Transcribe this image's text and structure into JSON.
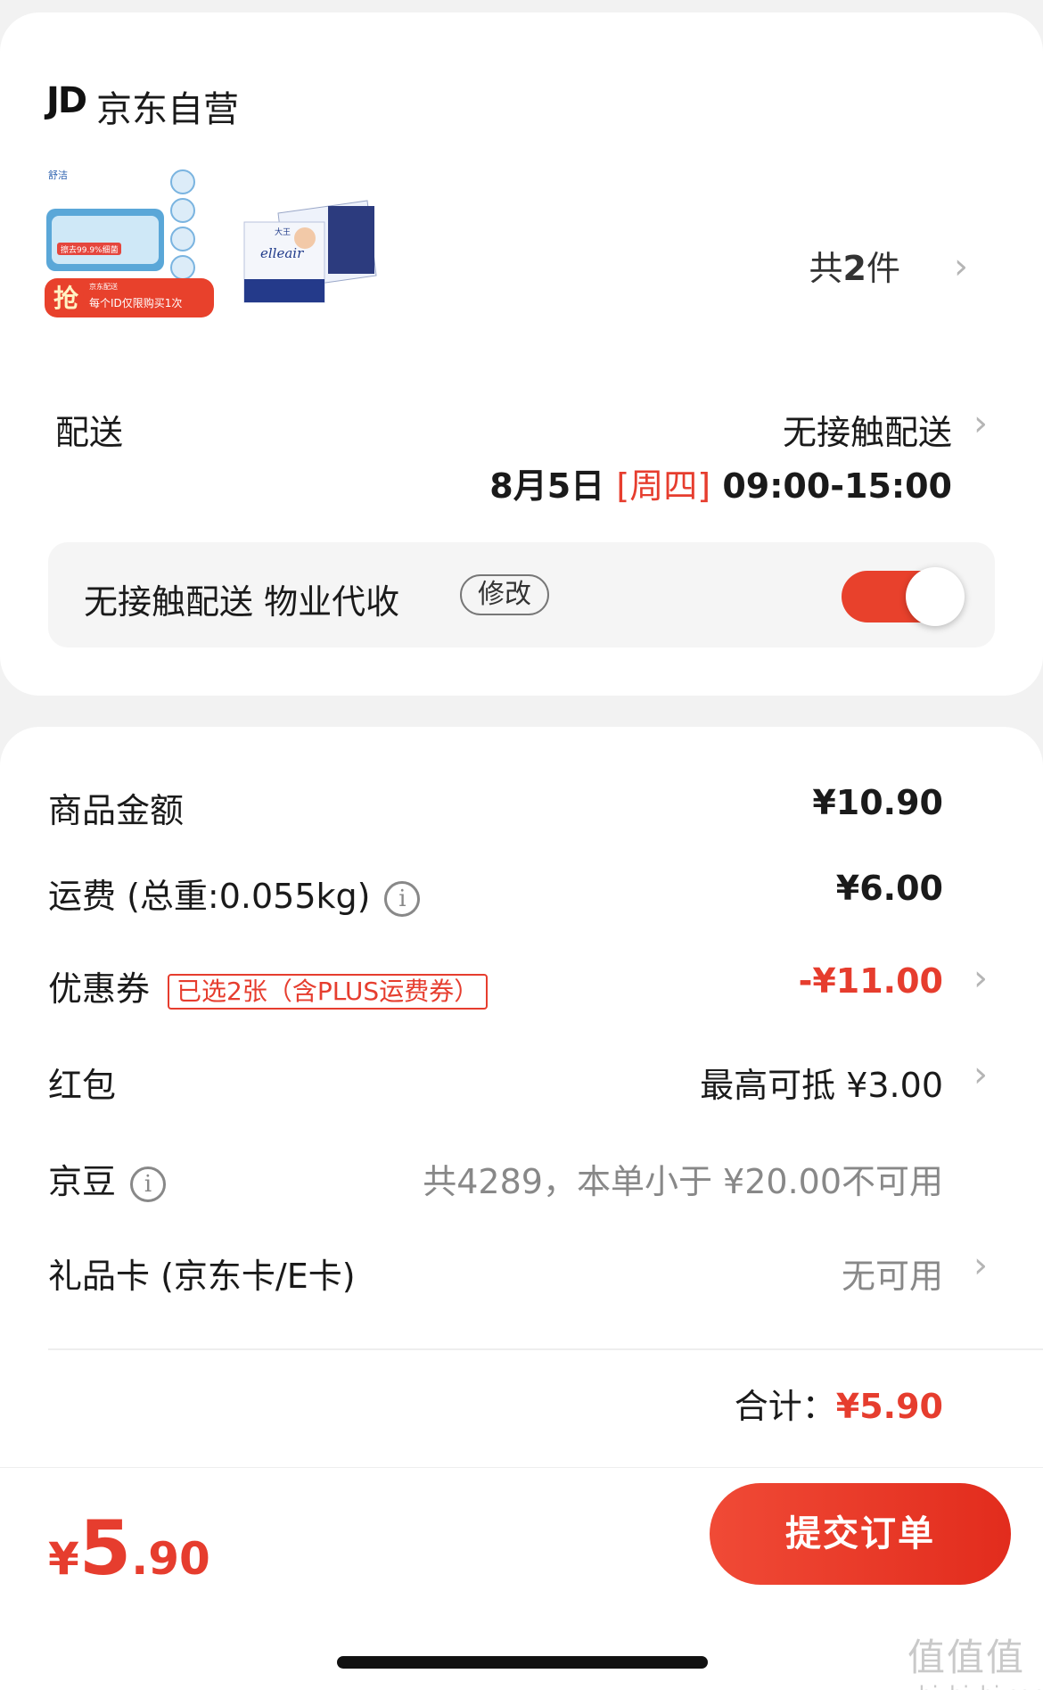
{
  "shop": {
    "logo": "JD",
    "name": "京东自营",
    "product_count_prefix": "共",
    "product_count": "2",
    "product_count_suffix": "件"
  },
  "product1": {
    "brand": "舒洁",
    "badge": "抢",
    "tag": "京东配送",
    "note": "每个ID仅限购买1次",
    "claim": "擦去99.9%细菌"
  },
  "product2": {
    "brand": "elleair",
    "brand_cn": "大王"
  },
  "delivery": {
    "label": "配送",
    "method": "无接触配送",
    "date": "8月5日",
    "weekday": "[周四]",
    "time": "09:00-15:00",
    "contactless_text": "无接触配送  物业代收",
    "edit_label": "修改",
    "toggle_on": true
  },
  "fees": {
    "goods_label": "商品金额",
    "goods_value": "¥10.90",
    "shipping_label": "运费 (总重:0.055kg)",
    "shipping_value": "¥6.00",
    "coupon_label": "优惠券",
    "coupon_tag": "已选2张（含PLUS运费券）",
    "coupon_value": "-¥11.00",
    "redpacket_label": "红包",
    "redpacket_value": "最高可抵 ¥3.00",
    "jingdou_label": "京豆",
    "jingdou_value": "共4289，本单小于 ¥20.00不可用",
    "giftcard_label": "礼品卡 (京东卡/E卡)",
    "giftcard_value": "无可用",
    "total_label": "合计：",
    "total_value": "¥5.90"
  },
  "bottom": {
    "currency": "¥",
    "price_int": "5",
    "price_dec": ".90",
    "submit_label": "提交订单"
  },
  "watermark": {
    "glyphs": "值值值",
    "site": "zhizhizhi.com"
  },
  "colors": {
    "accent": "#e63d2e",
    "background": "#f2f2f2"
  }
}
